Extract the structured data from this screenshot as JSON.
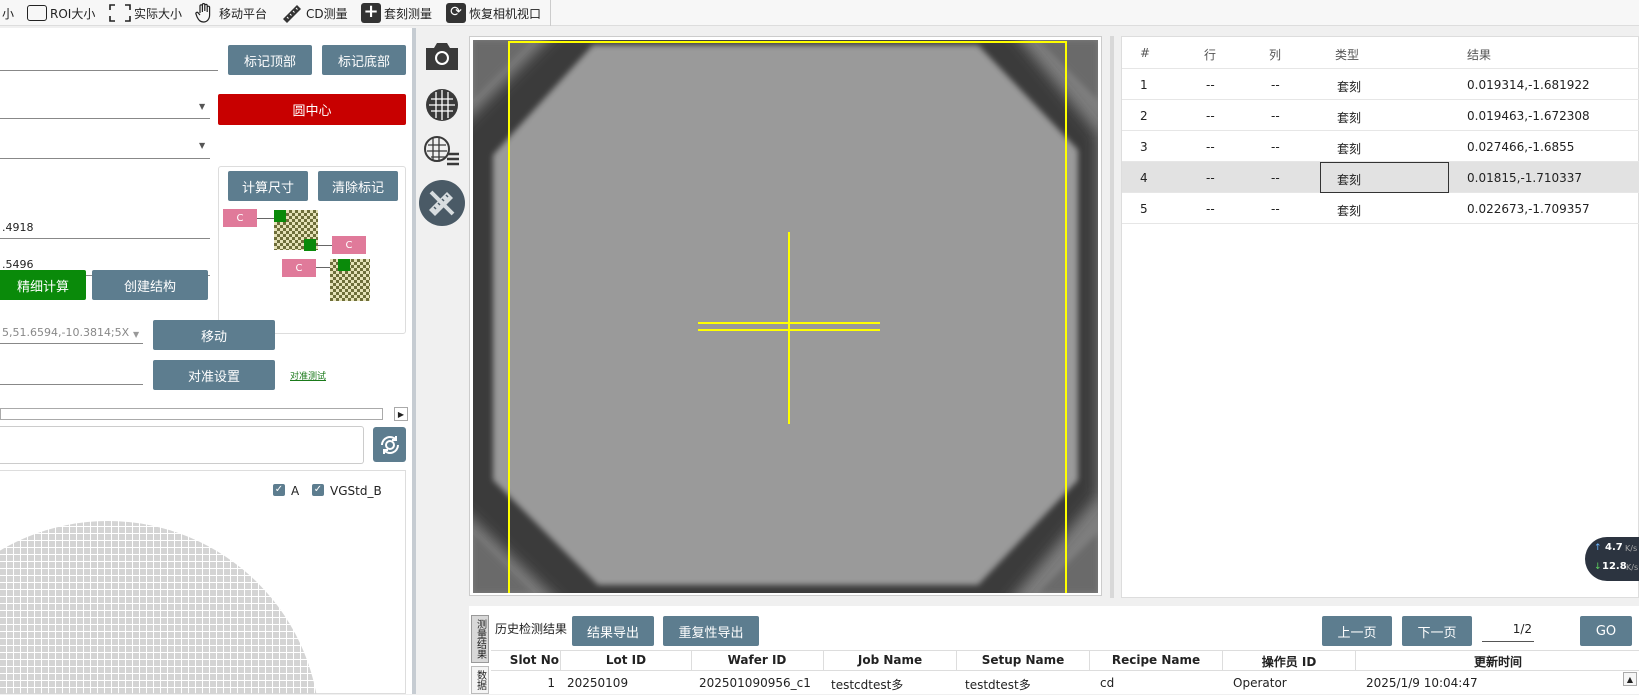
{
  "toolbar": {
    "items": [
      {
        "label": "小",
        "icon": "zoom-out-icon"
      },
      {
        "label": "ROI大小",
        "icon": "roi-box-icon"
      },
      {
        "label": "实际大小",
        "icon": "actual-size-icon"
      },
      {
        "label": "移动平台",
        "icon": "hand-icon"
      },
      {
        "label": "CD测量",
        "icon": "ruler-icon"
      },
      {
        "label": "套刻测量",
        "icon": "plus-icon"
      },
      {
        "label": "恢复相机视口",
        "icon": "refresh-icon"
      }
    ]
  },
  "left": {
    "mark_top": "标记顶部",
    "mark_bottom": "标记底部",
    "circle_center": "圆中心",
    "calc_size": "计算尺寸",
    "clear_marks": "清除标记",
    "value1": ".4918",
    "value2": ".5496",
    "fine_calc": "精细计算",
    "create_struct": "创建结构",
    "position": "5,51.6594,-10.3814;5X",
    "move": "移动",
    "align_settings": "对准设置",
    "align_test": "对准测试",
    "diagram_label": "C",
    "checkbox_a": "A",
    "checkbox_b": "VGStd_B"
  },
  "results": {
    "headers": [
      "#",
      "行",
      "列",
      "类型",
      "结果"
    ],
    "rows": [
      {
        "no": "1",
        "row": "--",
        "col": "--",
        "type": "套刻",
        "result": "0.019314,-1.681922"
      },
      {
        "no": "2",
        "row": "--",
        "col": "--",
        "type": "套刻",
        "result": "0.019463,-1.672308"
      },
      {
        "no": "3",
        "row": "--",
        "col": "--",
        "type": "套刻",
        "result": "0.027466,-1.6855"
      },
      {
        "no": "4",
        "row": "--",
        "col": "--",
        "type": "套刻",
        "result": "0.01815,-1.710337"
      },
      {
        "no": "5",
        "row": "--",
        "col": "--",
        "type": "套刻",
        "result": "0.022673,-1.709357"
      }
    ],
    "selected_row": 4
  },
  "net": {
    "up": "4.7",
    "down": "12.8",
    "unit": "K/s"
  },
  "history": {
    "title": "历史检测结果",
    "tab_vertical": "测量结果",
    "tab_vertical2": "数据",
    "export_results": "结果导出",
    "export_repeat": "重复性导出",
    "prev_page": "上一页",
    "next_page": "下一页",
    "page_indicator": "1/2",
    "go": "GO",
    "headers": [
      "Slot No",
      "Lot ID",
      "Wafer ID",
      "Job Name",
      "Setup Name",
      "Recipe Name",
      "操作员 ID",
      "更新时间"
    ],
    "rows": [
      {
        "slot": "1",
        "lot": "20250109",
        "wafer": "202501090956_c1",
        "job": "testcdtest多",
        "setup": "testdtest多",
        "recipe": "cd",
        "operator": "Operator",
        "time": "2025/1/9 10:04:47"
      }
    ]
  },
  "colors": {
    "button": "#5d7d8f",
    "red_button": "#c80000",
    "green_button": "#0a8a0a",
    "crosshair": "#ffff00"
  }
}
